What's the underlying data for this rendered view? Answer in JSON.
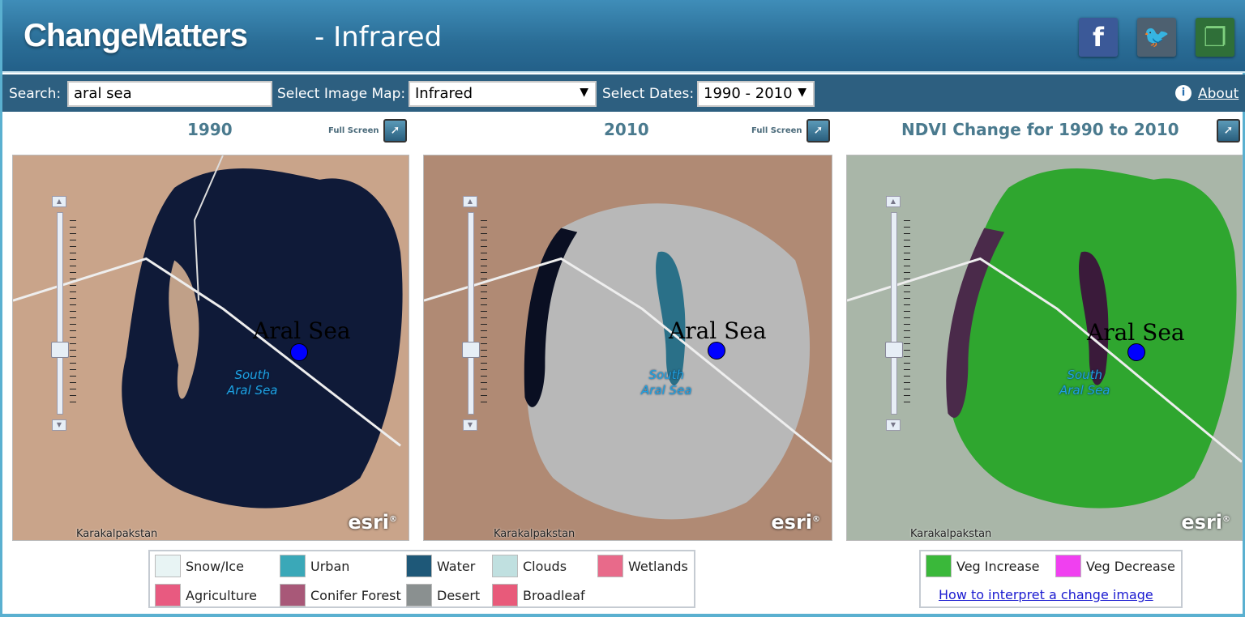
{
  "header": {
    "logo": "ChangeMatters",
    "subtitle": "- Infrared",
    "social": [
      {
        "name": "facebook",
        "glyph": "f",
        "color": "#3b5998"
      },
      {
        "name": "twitter",
        "glyph": "🐦",
        "color": "#4a6a80"
      },
      {
        "name": "share",
        "glyph": "❐",
        "color": "#2e7a3a"
      }
    ]
  },
  "toolbar": {
    "search_label": "Search:",
    "search_value": "aral sea",
    "image_map_label": "Select Image Map:",
    "image_map_value": "Infrared",
    "dates_label": "Select Dates:",
    "dates_value": "1990 - 2010",
    "about": "About"
  },
  "panels": [
    {
      "title": "1990",
      "full_screen": "Full Screen"
    },
    {
      "title": "2010",
      "full_screen": "Full Screen"
    },
    {
      "title": "NDVI Change for 1990 to 2010"
    }
  ],
  "map_labels": {
    "place": "Aral Sea",
    "south": "South\nAral Sea",
    "region": "Karakalpakstan",
    "attribution": "esri"
  },
  "legend": {
    "items": [
      {
        "label": "Snow/Ice",
        "color": "#e8f4f4"
      },
      {
        "label": "Urban",
        "color": "#3aa8b8"
      },
      {
        "label": "Water",
        "color": "#1e5878"
      },
      {
        "label": "Clouds",
        "color": "#c0e0e0"
      },
      {
        "label": "Wetlands",
        "color": "#e86a8a"
      },
      {
        "label": "Agriculture",
        "color": "#e85a80"
      },
      {
        "label": "Conifer Forest",
        "color": "#a85878"
      },
      {
        "label": "Desert",
        "color": "#8a9090"
      },
      {
        "label": "Broadleaf",
        "color": "#e85a7a"
      }
    ]
  },
  "change_legend": {
    "items": [
      {
        "label": "Veg Increase",
        "color": "#3ab83a"
      },
      {
        "label": "Veg Decrease",
        "color": "#f040f0"
      }
    ],
    "link": "How to interpret a change image"
  }
}
